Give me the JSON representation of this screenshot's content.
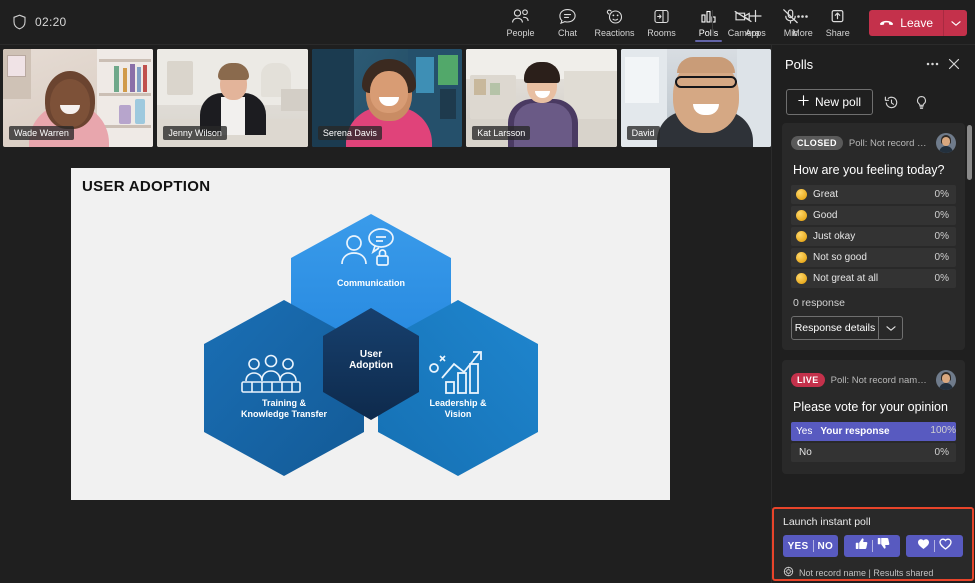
{
  "topbar": {
    "shield_icon": "shield-icon",
    "timer": "02:20",
    "tools": [
      {
        "label": "People",
        "icon": "people-icon",
        "active": false
      },
      {
        "label": "Chat",
        "icon": "chat-icon",
        "active": false
      },
      {
        "label": "Reactions",
        "icon": "reactions-icon",
        "active": false
      },
      {
        "label": "Rooms",
        "icon": "rooms-icon",
        "active": false
      },
      {
        "label": "Polls",
        "icon": "polls-icon",
        "active": true
      },
      {
        "label": "Apps",
        "icon": "apps-plus-icon",
        "active": false
      },
      {
        "label": "More",
        "icon": "more-ellipsis-icon",
        "active": false
      }
    ],
    "devices": [
      {
        "label": "Camera",
        "icon": "camera-off-icon"
      },
      {
        "label": "Mic",
        "icon": "mic-off-icon"
      },
      {
        "label": "Share",
        "icon": "share-screen-icon"
      }
    ],
    "leave_label": "Leave",
    "leave_icon": "phone-hangup-icon",
    "leave_caret_icon": "chevron-down-icon",
    "leave_color": "#c4314b"
  },
  "video_strip": {
    "participants": [
      {
        "name": "Wade Warren"
      },
      {
        "name": "Jenny Wilson"
      },
      {
        "name": "Serena Davis"
      },
      {
        "name": "Kat Larsson"
      },
      {
        "name": "David"
      }
    ]
  },
  "slide": {
    "title": "USER ADOPTION",
    "center_label_line1": "User",
    "center_label_line2": "Adoption",
    "nodes": [
      {
        "label_line1": "Communication",
        "label_line2": "",
        "icon": "person-chat-icon",
        "color": "#2b8fe8"
      },
      {
        "label_line1": "Training &",
        "label_line2": "Knowledge Transfer",
        "icon": "group-training-icon",
        "color": "#1267ad"
      },
      {
        "label_line1": "Leadership &",
        "label_line2": "Vision",
        "icon": "growth-chart-icon",
        "color": "#1b7fd4"
      }
    ],
    "center_color": "#12355e",
    "background": "#f1f1f1"
  },
  "polls": {
    "panel_title": "Polls",
    "more_icon": "more-ellipsis-icon",
    "close_icon": "close-icon",
    "new_poll_label": "New poll",
    "new_poll_icon": "plus-icon",
    "history_icon": "history-rewind-icon",
    "tips_icon": "lightbulb-icon",
    "cards": [
      {
        "status": "CLOSED",
        "status_kind": "closed",
        "source": "Poll: Not record name |...",
        "question": "How are you feeling today?",
        "options": [
          {
            "label": "Great",
            "percent": "0%",
            "icon": "emoji-great-icon",
            "selected": false
          },
          {
            "label": "Good",
            "percent": "0%",
            "icon": "emoji-good-icon",
            "selected": false
          },
          {
            "label": "Just okay",
            "percent": "0%",
            "icon": "emoji-okay-icon",
            "selected": false
          },
          {
            "label": "Not so good",
            "percent": "0%",
            "icon": "emoji-notsogood-icon",
            "selected": false
          },
          {
            "label": "Not great at all",
            "percent": "0%",
            "icon": "emoji-notgreat-icon",
            "selected": false
          }
        ],
        "response_count": "0 response",
        "response_details_label": "Response details",
        "response_details_caret": "chevron-down-icon"
      },
      {
        "status": "LIVE",
        "status_kind": "live",
        "source": "Poll: Not record name | Res...",
        "question": "Please vote for your opinion",
        "options": [
          {
            "label": "Yes",
            "percent": "100%",
            "selected": true,
            "selected_note": "Your response"
          },
          {
            "label": "No",
            "percent": "0%",
            "selected": false,
            "selected_note": ""
          }
        ]
      }
    ]
  },
  "instant_poll": {
    "title": "Launch instant poll",
    "highlight_color": "#e8442a",
    "buttons": [
      {
        "name": "yes-no",
        "yes": "YES",
        "no": "NO"
      },
      {
        "name": "thumbs",
        "icon_a": "thumbs-up-icon",
        "icon_b": "thumbs-down-icon"
      },
      {
        "name": "hearts",
        "icon_a": "heart-filled-icon",
        "icon_b": "heart-outline-icon"
      }
    ],
    "footer_icon": "settings-gear-icon",
    "footer_text": "Not record name | Results shared"
  }
}
